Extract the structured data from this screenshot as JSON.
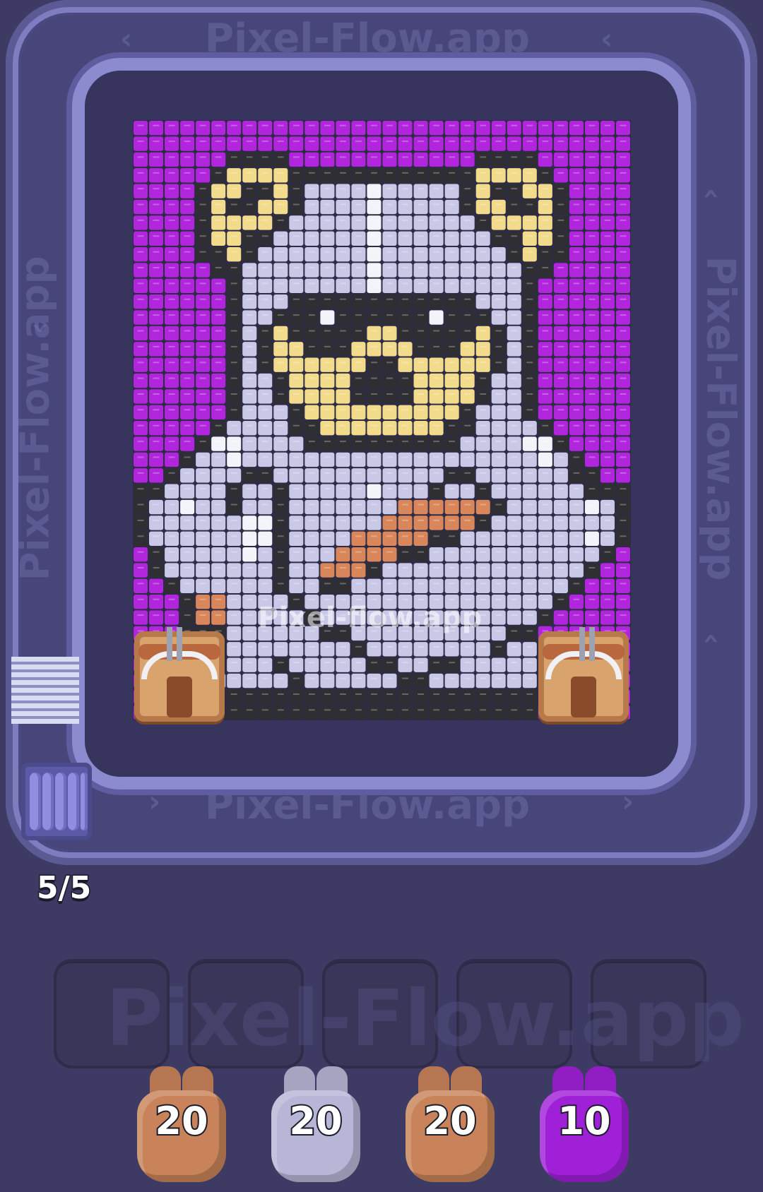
{
  "watermarks": {
    "track_top": "Pixel-Flow.app",
    "track_bottom": "Pixel-Flow.app",
    "track_left": "Pixel-Flow.app",
    "track_right": "Pixel-Flow.app",
    "canvas": "Pixel-flow.app",
    "slots": "Pixel-Flow.app"
  },
  "queue": {
    "counter": "5/5"
  },
  "slots": {
    "count": 5,
    "filled": 0
  },
  "shooters": [
    {
      "label": "20",
      "color": "#c9835a",
      "name": "brown"
    },
    {
      "label": "20",
      "color": "#b7b6d6",
      "name": "silver"
    },
    {
      "label": "20",
      "color": "#c9835a",
      "name": "brown"
    },
    {
      "label": "10",
      "color": "#a020d8",
      "name": "purple"
    }
  ],
  "palette": {
    "P": "#b126dc",
    "K": "#2f2f33",
    "S": "#c9c8e6",
    "G": "#a4a3c8",
    "W": "#f3f3fa",
    "Y": "#f2dc8c",
    "O": "#d9875a",
    "D": "#4a4a50"
  },
  "pixel_grid": [
    "PPPPPPPPPPPPPPPPPPPPPPPPPPPPPPPP",
    "PPPPPPPPPPPPPPPPPPPPPPPPPPPPPPPP",
    "PPPPPPKKKKPPPPPPPPPPPPKKKKPPPPPP",
    "PPPPPKYYYYKKKKKKKKKKKKYYYYKPPPPP",
    "PPPPKYYKKYKSSSSWSSSSSKYKKYYKPPPP",
    "PPPPKYKKYYKSSSSWSSSSSKYYKKYKPPPP",
    "PPPPKYYYYKSSSSSWSSSSSSKYYYYKPPPP",
    "PPPPKYYKKSSSSSSWSSSSSSSKKYYKPPPP",
    "PPPPKKYKSSSSSSSWSSSSSSSSKYKKPPPP",
    "PPPPPKKSSSSSSSSWSSSSSSSSSKKPPPPP",
    "PPPPPPKSSSSSSSSWSSSSSSSSSKPPPPPP",
    "PPPPPPKSSSKKKKKKKKKKKKSSSKPPPPPP",
    "PPPPPPKSSKKKWKKKKKKWKKKSSKPPPPPP",
    "PPPPPPKSKYKKKKKYYKKKKKYKSKPPPPPP",
    "PPPPPPKSKYYKKKYYYYKKKYYKSKPPPPPP",
    "PPPPPPKSKYYYYYYKKYYYYYYKSKPPPPPP",
    "PPPPPPKSSKYYYYKKKKYYYYKSSKPPPPPP",
    "PPPPPPKSSKYYYYKKKKYYYYKSSKPPPPPP",
    "PPPPPPKSSSKYYYYYYYYYYKSSSKPPPPPP",
    "PPPPPKSSSSKKYYYYYYYYKKSSSSKPPPPP",
    "PPPPKWWSSSSKKKKKKKKKKSSSSWWKPPPP",
    "PPPKSSWSSSSSSSSSSSSSSSSSSSWSKPPP",
    "PPKSSSSKKSSSSSSSSSSSKKSSSSSSKKPP",
    "KKSSSSKSSKSSSSSWSSSKSSKSSSSSSKKK",
    "KSSWSSKSSKSSSSSSSOOOOOOKSSSSSWSK",
    "KSSSSSSWWKSSSSSSOOOOOOKSSSSSSSSK",
    "KSSSSSSWWKSSSSOOOOOKKSSSSSSSSWSK",
    "PKSSSSSWSKSSSOOOOKKSSSSSSSSSSSKP",
    "PKSSSSSSSKSSOOOKSSSSSSSSSSSSSKPP",
    "PPKSSSSSSKSSKKSSSSSSSSSSSSSSKPPP",
    "PPPKOOSSSSKSSSSSSSSSSSSSSSSKPPPP",
    "PPPKOOSSSSSKSSSSSSSSSSSSSSKPPPPP",
    "PPPKKKSSSSSSKKSSSSSSSSSSKKPPPPPP",
    "PPPPPKSSSSSSSSKSSSSSSSSKSSKPPPPP",
    "PPPPKKSSSKSSSSSKKSSKKSSSSSKPPPPP",
    "PPPPKSSSSSKSSSSSSKKSSSSSSSKPPPPP",
    "PPPPKKKKKKKKKKKKKKKKKKKKKKKPPPPP",
    "PPPPPKKKKKKKKKKKKKKKKKKKKKPPPPPP"
  ]
}
